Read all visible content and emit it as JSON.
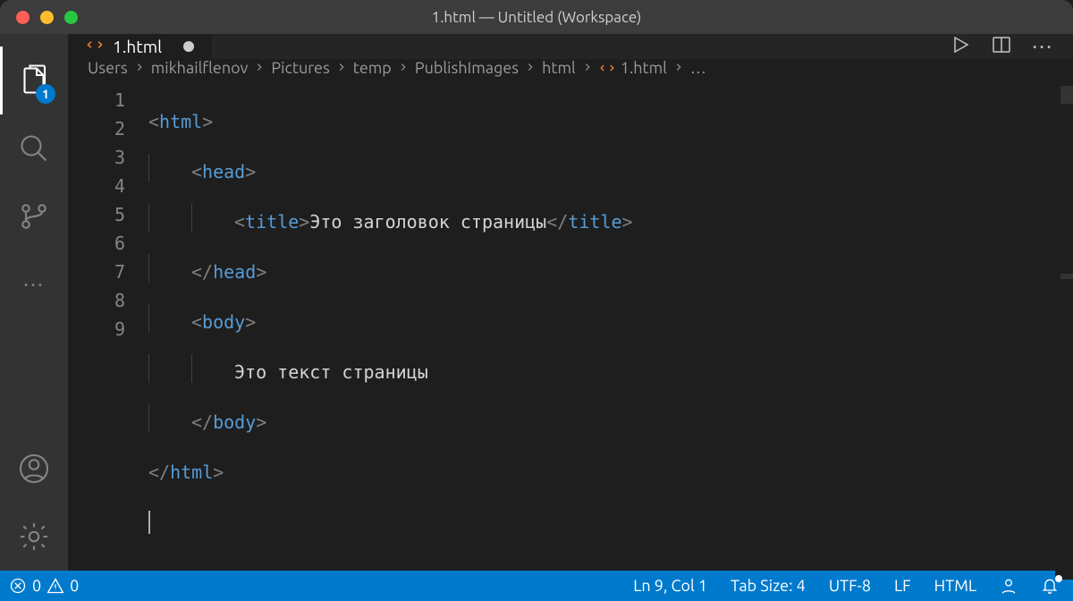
{
  "window": {
    "title": "1.html — Untitled (Workspace)"
  },
  "activity_bar": {
    "explorer_badge": "1"
  },
  "tabs": {
    "active": {
      "label": "1.html"
    }
  },
  "breadcrumbs": {
    "items": [
      "Users",
      "mikhailflenov",
      "Pictures",
      "temp",
      "PublishImages",
      "html",
      "1.html",
      "…"
    ]
  },
  "editor": {
    "line_numbers": [
      "1",
      "2",
      "3",
      "4",
      "5",
      "6",
      "7",
      "8",
      "9"
    ],
    "code": {
      "l1": {
        "open": "<",
        "tag": "html",
        "close": ">"
      },
      "l2": {
        "open": "<",
        "tag": "head",
        "close": ">"
      },
      "l3": {
        "open": "<",
        "tag": "title",
        "close_open": ">",
        "text": "Это заголовок страницы",
        "open_end": "</",
        "tag2": "title",
        "close_end": ">"
      },
      "l4": {
        "open": "</",
        "tag": "head",
        "close": ">"
      },
      "l5": {
        "open": "<",
        "tag": "body",
        "close": ">"
      },
      "l6": {
        "text": "Это текст страницы"
      },
      "l7": {
        "open": "</",
        "tag": "body",
        "close": ">"
      },
      "l8": {
        "open": "</",
        "tag": "html",
        "close": ">"
      }
    }
  },
  "statusbar": {
    "errors": "0",
    "warnings": "0",
    "line_col": "Ln 9, Col 1",
    "tab_size": "Tab Size: 4",
    "encoding": "UTF-8",
    "eol": "LF",
    "language": "HTML"
  }
}
